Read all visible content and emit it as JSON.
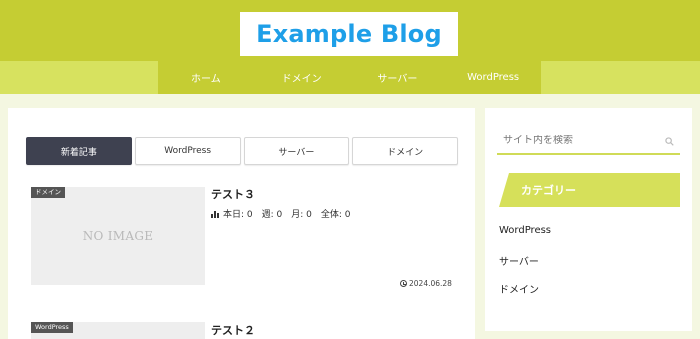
{
  "header": {
    "site_title": "Example Blog"
  },
  "nav": {
    "items": [
      {
        "label": "ホーム"
      },
      {
        "label": "ドメイン"
      },
      {
        "label": "サーバー"
      },
      {
        "label": "WordPress"
      }
    ]
  },
  "tabs": [
    {
      "label": "新着記事",
      "active": true
    },
    {
      "label": "WordPress",
      "active": false
    },
    {
      "label": "サーバー",
      "active": false
    },
    {
      "label": "ドメイン",
      "active": false
    }
  ],
  "posts": [
    {
      "category": "ドメイン",
      "thumbnail_text": "NO IMAGE",
      "title": "テスト３",
      "views_text": "本日: 0　週: 0　月: 0　全体: 0",
      "date": "2024.06.28"
    },
    {
      "category": "WordPress",
      "title": "テスト２"
    }
  ],
  "sidebar": {
    "search_placeholder": "サイト内を検索",
    "category_heading": "カテゴリー",
    "categories": [
      {
        "label": "WordPress"
      },
      {
        "label": "サーバー"
      },
      {
        "label": "ドメイン"
      }
    ]
  },
  "colors": {
    "header_bg": "#c5cd33",
    "nav_strip_bg": "#d7e25f",
    "page_bg": "#f4f7e1",
    "logo_text": "#1e9fe8",
    "active_tab_bg": "#3e4150",
    "accent": "#d6e05a"
  }
}
